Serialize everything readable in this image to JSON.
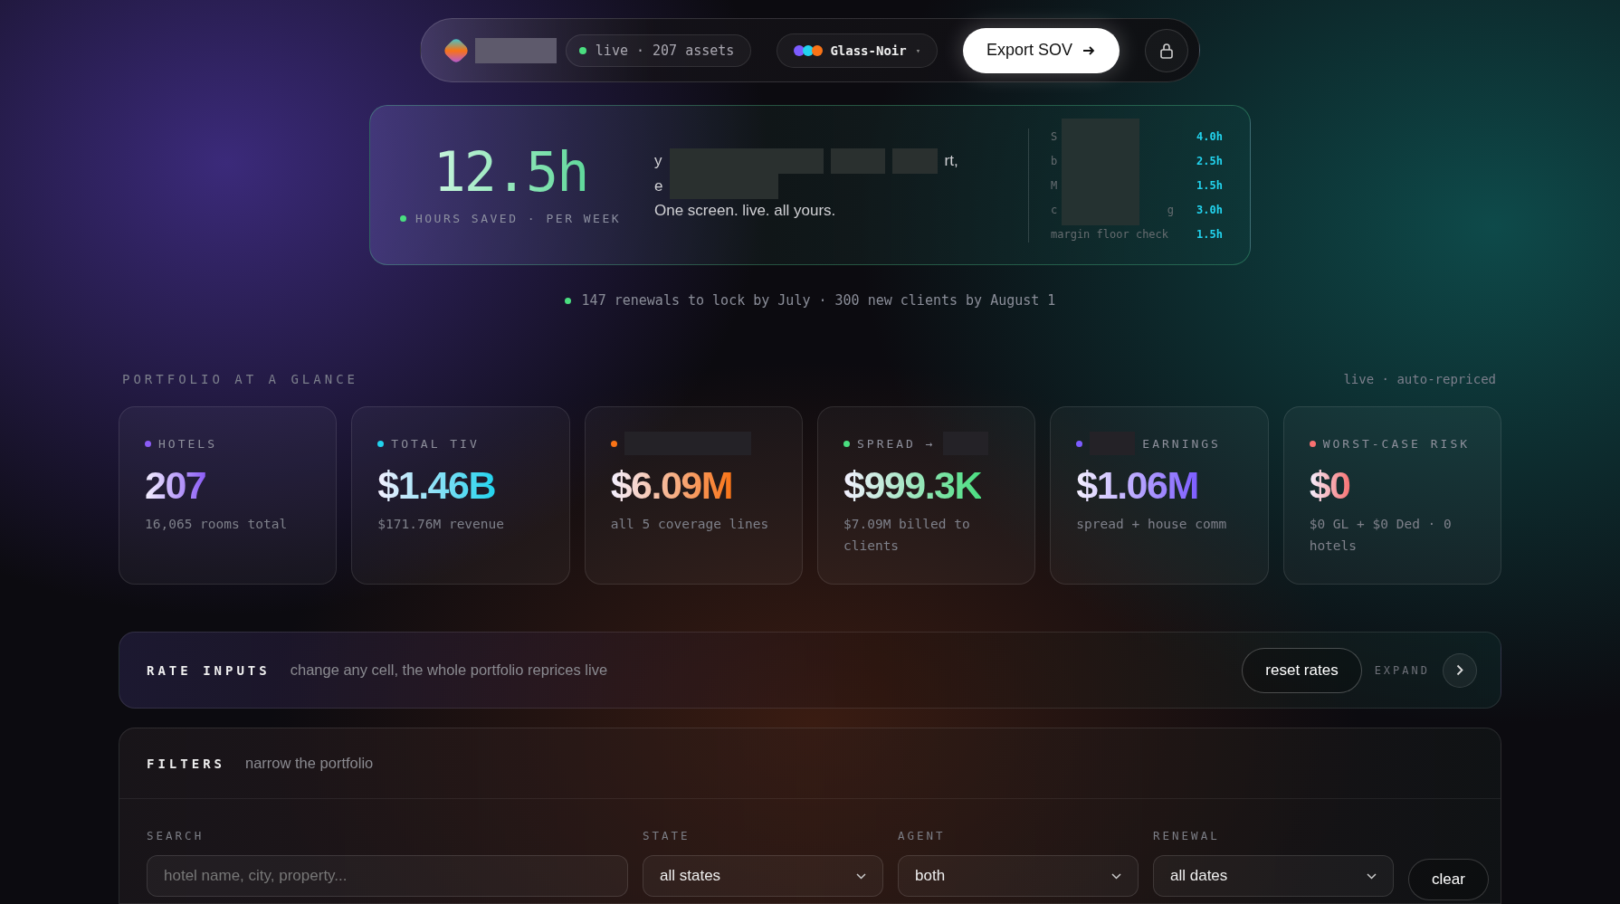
{
  "topbar": {
    "status": "live · 207 assets",
    "theme": {
      "label": "Glass-Noir",
      "caret": "▾",
      "swatches": [
        {
          "color": "#7c5cff"
        },
        {
          "color": "#22d3ee"
        },
        {
          "color": "#f97316"
        }
      ]
    },
    "export_button": "Export SOV"
  },
  "hero": {
    "value": "12.5h",
    "caption": "HOURS SAVED · PER WEEK",
    "text_lines": [
      [
        "y",
        "rt,"
      ],
      [
        "e"
      ],
      [
        "One screen. live. all yours."
      ]
    ],
    "breakdown": [
      {
        "label": [
          "S"
        ],
        "hours": "4.0h"
      },
      {
        "label": [
          "b"
        ],
        "hours": "2.5h"
      },
      {
        "label": [
          "M"
        ],
        "hours": "1.5h"
      },
      {
        "label": [
          "c",
          "g"
        ],
        "hours": "3.0h"
      },
      {
        "label": [
          "margin floor check"
        ],
        "hours": "1.5h"
      }
    ]
  },
  "status_line": "147 renewals to lock by July · 300 new clients by August 1",
  "portfolio": {
    "title": "PORTFOLIO AT A GLANCE",
    "note": "live · auto-repriced",
    "cards": [
      {
        "label": "HOTELS",
        "kind": "plain",
        "color": "#8b5cf6",
        "value": "207",
        "sub": "16,065 rooms total"
      },
      {
        "label": "TOTAL TIV",
        "kind": "plain",
        "color": "#22d3ee",
        "value": "$1.46B",
        "sub": "$171.76M revenue"
      },
      {
        "kind": "masked",
        "color": "#f97316",
        "value": "$6.09M",
        "sub": "all 5 coverage lines"
      },
      {
        "label": "SPREAD →",
        "kind": "masktail",
        "color": "#4ade80",
        "value": "$999.3K",
        "sub": "$7.09M billed to clients"
      },
      {
        "label": "EARNINGS",
        "kind": "maskhead",
        "color": "#7c5cff",
        "value": "$1.06M",
        "sub": "spread + house comm"
      },
      {
        "label": "WORST-CASE RISK",
        "kind": "plain",
        "color": "#f87171",
        "value": "$0",
        "sub": "$0 GL + $0 Ded · 0 hotels"
      }
    ]
  },
  "rate_inputs": {
    "title": "RATE INPUTS",
    "hint": "change any cell, the whole portfolio reprices live",
    "reset_button": "reset rates",
    "expand": "EXPAND"
  },
  "filters": {
    "title": "FILTERS",
    "hint": "narrow the portfolio",
    "fields": [
      {
        "kind": "text",
        "label": "SEARCH",
        "placeholder": "hotel name, city, property..."
      },
      {
        "kind": "select",
        "label": "STATE",
        "value": "all states"
      },
      {
        "kind": "select",
        "label": "AGENT",
        "value": "both"
      },
      {
        "kind": "select",
        "label": "RENEWAL",
        "value": "all dates"
      }
    ],
    "clear_button": "clear"
  }
}
